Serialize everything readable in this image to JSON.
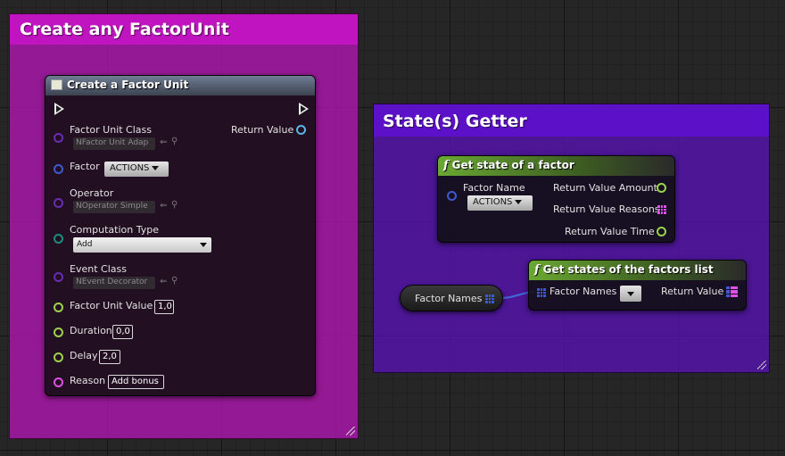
{
  "comments": {
    "create": {
      "title": "Create any FactorUnit"
    },
    "getter": {
      "title": "State(s) Getter"
    }
  },
  "create_node": {
    "title": "Create a Factor Unit",
    "factor_unit_class": {
      "label": "Factor Unit Class",
      "value": "NFactor Unit Adap"
    },
    "return_value": "Return Value",
    "factor": {
      "label": "Factor",
      "value": "ACTIONS"
    },
    "operator": {
      "label": "Operator",
      "value": "NOperator Simple"
    },
    "computation_type": {
      "label": "Computation Type",
      "value": "Add"
    },
    "event_class": {
      "label": "Event Class",
      "value": "NEvent Decorator"
    },
    "factor_unit_value": {
      "label": "Factor Unit Value",
      "value": "1,0"
    },
    "duration": {
      "label": "Duration",
      "value": "0,0"
    },
    "delay": {
      "label": "Delay",
      "value": "2,0"
    },
    "reason": {
      "label": "Reason",
      "value": "Add bonus"
    }
  },
  "get_state_node": {
    "title": "Get state of a factor",
    "factor_name": {
      "label": "Factor Name",
      "value": "ACTIONS"
    },
    "outputs": [
      "Return Value Amount",
      "Return Value Reasons",
      "Return Value Time"
    ]
  },
  "factor_names_var": {
    "label": "Factor Names"
  },
  "get_states_node": {
    "title": "Get states of the factors list",
    "input_label": "Factor Names",
    "output_label": "Return Value"
  },
  "colors": {
    "comment_magenta": "#b316b3",
    "comment_purple": "#5c10c0",
    "pure_function_header": "#5a8a2e",
    "struct_pin": "#3f5ad0",
    "float_pin": "#9cd24a",
    "string_pin": "#e050e8",
    "object_pin": "#5bb4e8",
    "byte_pin": "#1c8c7c",
    "class_pin": "#6a2bb5"
  }
}
